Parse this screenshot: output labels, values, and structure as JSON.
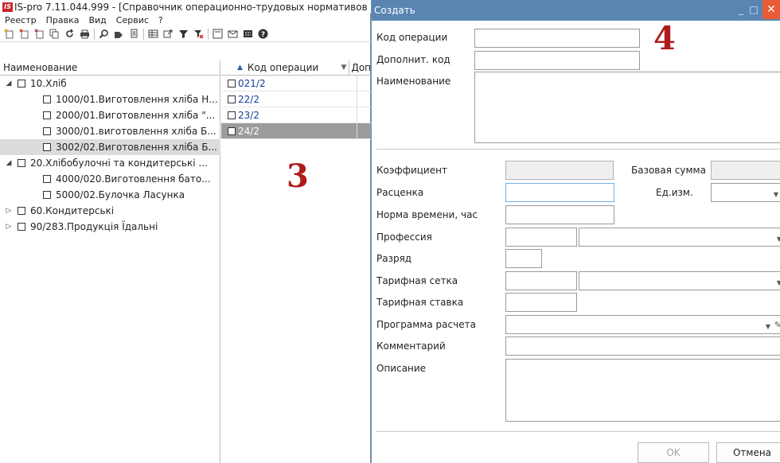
{
  "main_window": {
    "title": "IS-pro 7.11.044.999 - [Справочник операционно-трудовых нормативов",
    "app_icon_text": "IS",
    "menu": [
      "Реестр",
      "Правка",
      "Вид",
      "Сервис",
      "?"
    ],
    "toolbar_icons": [
      "new-doc-icon",
      "new-sub-icon",
      "new-child-icon",
      "copy-icon",
      "refresh-icon",
      "print-icon",
      "search-icon",
      "tag-icon",
      "report-icon",
      "grid-icon",
      "export-icon",
      "filter-icon",
      "clear-filter-icon",
      "form-icon",
      "mail-icon",
      "calc-icon",
      "help-icon"
    ]
  },
  "left_pane": {
    "header": "Наименование",
    "rows": [
      {
        "text": "10.Хліб",
        "level": 0,
        "expanded": true,
        "selected": false
      },
      {
        "text": "1000/01.Виготовлення хліба Н...",
        "level": 1,
        "expanded": null,
        "selected": false
      },
      {
        "text": "2000/01.Виготовлення хліба \"...",
        "level": 1,
        "expanded": null,
        "selected": false
      },
      {
        "text": "3000/01.виготовлення хліба Б...",
        "level": 1,
        "expanded": null,
        "selected": false
      },
      {
        "text": "3002/02.Виготовлення хліба Б...",
        "level": 1,
        "expanded": null,
        "selected": true
      },
      {
        "text": "20.Хлібобулочні та кондитерські ...",
        "level": 0,
        "expanded": true,
        "selected": false
      },
      {
        "text": "4000/020.Виготовлення бато...",
        "level": 1,
        "expanded": null,
        "selected": false
      },
      {
        "text": "5000/02.Булочка Ласунка",
        "level": 1,
        "expanded": null,
        "selected": false
      },
      {
        "text": "60.Кондитерські",
        "level": 0,
        "expanded": false,
        "selected": false
      },
      {
        "text": "90/283.Продукція Їдальні",
        "level": 0,
        "expanded": false,
        "selected": false
      }
    ]
  },
  "right_pane": {
    "col_code": "Код операции",
    "col_extra": "Доп",
    "rows": [
      {
        "code": "021/2",
        "selected": false
      },
      {
        "code": "22/2",
        "selected": false
      },
      {
        "code": "23/2",
        "selected": false
      },
      {
        "code": "24/2",
        "selected": true
      }
    ]
  },
  "callouts": {
    "three": "3",
    "four": "4"
  },
  "dialog": {
    "title": "Создать",
    "labels": {
      "op_code": "Код операции",
      "add_code": "Дополнит. код",
      "name": "Наименование",
      "coef": "Коэффициент",
      "base_sum": "Базовая сумма",
      "rate": "Расценка",
      "unit": "Ед.изм.",
      "time_norm": "Норма времени, час",
      "profession": "Профессия",
      "grade": "Разряд",
      "tariff_grid": "Тарифная сетка",
      "tariff_rate": "Тарифная ставка",
      "calc_program": "Программа расчета",
      "comment": "Комментарий",
      "description": "Описание"
    },
    "values": {
      "op_code": "",
      "add_code": "",
      "name": "",
      "coef": "",
      "base_sum": "",
      "rate": "",
      "unit": "",
      "time_norm": "",
      "profession_code": "",
      "profession": "",
      "grade": "",
      "tariff_grid_code": "",
      "tariff_grid": "",
      "tariff_rate": "",
      "calc_program": "",
      "comment": "",
      "description": ""
    },
    "buttons": {
      "ok": "OK",
      "cancel": "Отмена"
    }
  }
}
